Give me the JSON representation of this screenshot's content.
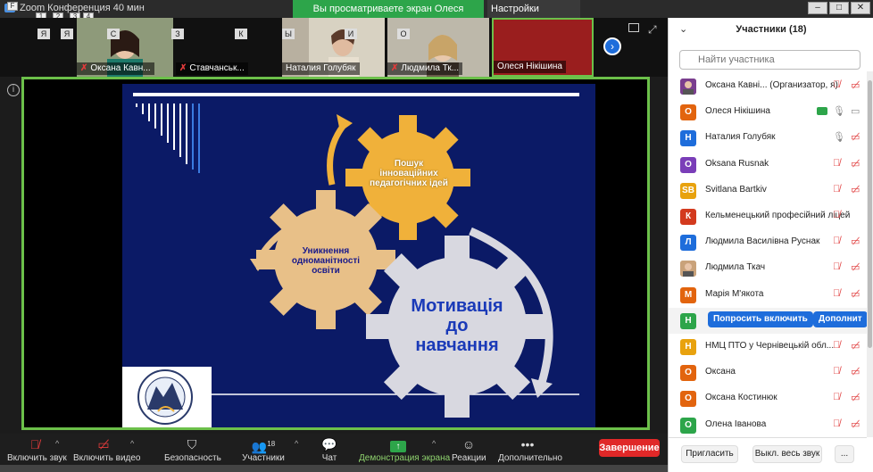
{
  "window": {
    "title": "Zoom Конференция 40 мин",
    "share_banner": "Вы просматриваете экран Олеся Нікішина",
    "view_settings": "Настройки просмотра",
    "shortcut_keys": [
      "1",
      "2",
      "3",
      "4"
    ],
    "min_label": "–",
    "max_label": "□",
    "close_label": "✕"
  },
  "thumbnails": [
    {
      "name": "Оксана Кавн...",
      "muted": true
    },
    {
      "name": "Ставчанськ...",
      "muted": true
    },
    {
      "name": "Наталия Голубяк",
      "muted": false
    },
    {
      "name": "Людмила Тк...",
      "muted": true
    },
    {
      "name": "Олеся Нікішина",
      "muted": false
    }
  ],
  "letter_tiles": [
    "Я",
    "С",
    "З",
    "К",
    "Ы",
    "И",
    "О"
  ],
  "slide": {
    "gear_top": "Пошук інноваційних педагогічних ідей",
    "gear_left": "Уникнення одноманітності освіти",
    "gear_big": "Мотивація до навчання"
  },
  "toolbar": {
    "audio": "Включить звук",
    "video": "Включить видео",
    "security": "Безопасность",
    "participants": "Участники",
    "participants_count": "18",
    "chat": "Чат",
    "share": "Демонстрация экрана",
    "reactions": "Реакции",
    "more": "Дополнительно",
    "end": "Завершение"
  },
  "panel": {
    "title": "Участники (18)",
    "search_placeholder": "Найти участника",
    "participants": [
      {
        "initial": "",
        "name": "Оксана Кавні...  (Организатор, я)",
        "color": "#7a3e8e",
        "photo": true,
        "mic": "off",
        "cam": "off",
        "share": false
      },
      {
        "initial": "О",
        "name": "Олеся Нікішина",
        "color": "#e2640e",
        "photo": false,
        "mic": "on",
        "cam": "on",
        "share": true
      },
      {
        "initial": "Н",
        "name": "Наталия Голубяк",
        "color": "#1e6ddb",
        "photo": false,
        "mic": "on",
        "cam": "off",
        "share": false
      },
      {
        "initial": "O",
        "name": "Oksana Rusnak",
        "color": "#7a3eb8",
        "photo": false,
        "mic": "off",
        "cam": "off",
        "share": false
      },
      {
        "initial": "SB",
        "name": "Svitlana Bartkiv",
        "color": "#e8a20e",
        "photo": false,
        "mic": "off",
        "cam": "off",
        "share": false
      },
      {
        "initial": "К",
        "name": "Кельменецький професійний ліцей",
        "color": "#d33a1e",
        "photo": false,
        "mic": "off",
        "cam": "none",
        "share": false
      },
      {
        "initial": "Л",
        "name": "Людмила Василівна Руснак",
        "color": "#1e6ddb",
        "photo": false,
        "mic": "off",
        "cam": "off",
        "share": false
      },
      {
        "initial": "",
        "name": "Людмила Ткач",
        "color": "#c9a27a",
        "photo": true,
        "mic": "off",
        "cam": "off",
        "share": false
      },
      {
        "initial": "М",
        "name": "Марія М'якота",
        "color": "#e2640e",
        "photo": false,
        "mic": "off",
        "cam": "off",
        "share": false
      },
      {
        "initial": "Н",
        "name": "",
        "color": "#2da54a",
        "photo": false,
        "mic": "none",
        "cam": "none",
        "share": false,
        "hover": true
      },
      {
        "initial": "Н",
        "name": "НМЦ ПТО у Чернівецькій обл...",
        "color": "#e8a20e",
        "photo": false,
        "mic": "off",
        "cam": "off",
        "share": false
      },
      {
        "initial": "О",
        "name": "Оксана",
        "color": "#e2640e",
        "photo": false,
        "mic": "off",
        "cam": "off",
        "share": false
      },
      {
        "initial": "О",
        "name": "Оксана Костинюк",
        "color": "#e2640e",
        "photo": false,
        "mic": "off",
        "cam": "off",
        "share": false
      },
      {
        "initial": "О",
        "name": "Олена Іванова",
        "color": "#2da54a",
        "photo": false,
        "mic": "off",
        "cam": "off",
        "share": false
      }
    ],
    "hover_ask": "Попросить включить",
    "hover_more": "Дополнит",
    "invite": "Пригласить",
    "mute_all": "Выкл. весь звук",
    "more": "..."
  }
}
